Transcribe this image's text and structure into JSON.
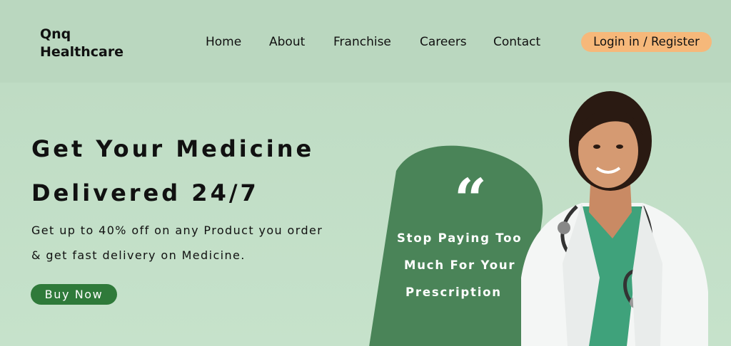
{
  "header": {
    "logo_line1": "Qnq",
    "logo_line2": "Healthcare",
    "nav": [
      {
        "label": "Home"
      },
      {
        "label": "About"
      },
      {
        "label": "Franchise"
      },
      {
        "label": "Careers"
      },
      {
        "label": "Contact"
      }
    ],
    "login_label": "Login in / Register"
  },
  "hero": {
    "title_line1": "Get Your Medicine",
    "title_line2": "Delivered 24/7",
    "subtitle_line1": "Get up to 40% off on any Product you order",
    "subtitle_line2": "& get fast delivery on  Medicine.",
    "buy_label": "Buy Now"
  },
  "quote": {
    "mark": "“",
    "line1": "Stop Paying Too",
    "line2": "Much For Your",
    "line3": "Prescription"
  },
  "colors": {
    "background": "#bfdcc4",
    "accent_green": "#2f7a3a",
    "blob_green": "#4a8458",
    "login_orange": "#f6b87a"
  }
}
